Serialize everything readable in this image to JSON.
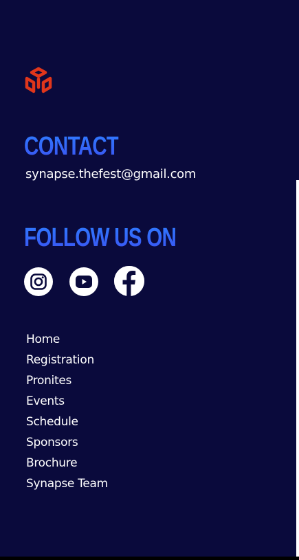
{
  "contact": {
    "title": "Contact",
    "email": "synapse.thefest@gmail.com"
  },
  "follow": {
    "title": "Follow us on",
    "socials": [
      {
        "icon": "instagram-icon"
      },
      {
        "icon": "youtube-icon"
      },
      {
        "icon": "facebook-icon"
      }
    ]
  },
  "nav": {
    "items": [
      "Home",
      "Registration",
      "Pronites",
      "Events",
      "Schedule",
      "Sponsors",
      "Brochure",
      "Synapse Team"
    ]
  },
  "colors": {
    "background": "#0a0a3c",
    "heading_gradient_top": "#2f7bff",
    "heading_gradient_bottom": "#3a55f2",
    "logo": "#e0361b",
    "text": "#ffffff"
  },
  "logo": {
    "icon": "cubes-logo-icon"
  }
}
